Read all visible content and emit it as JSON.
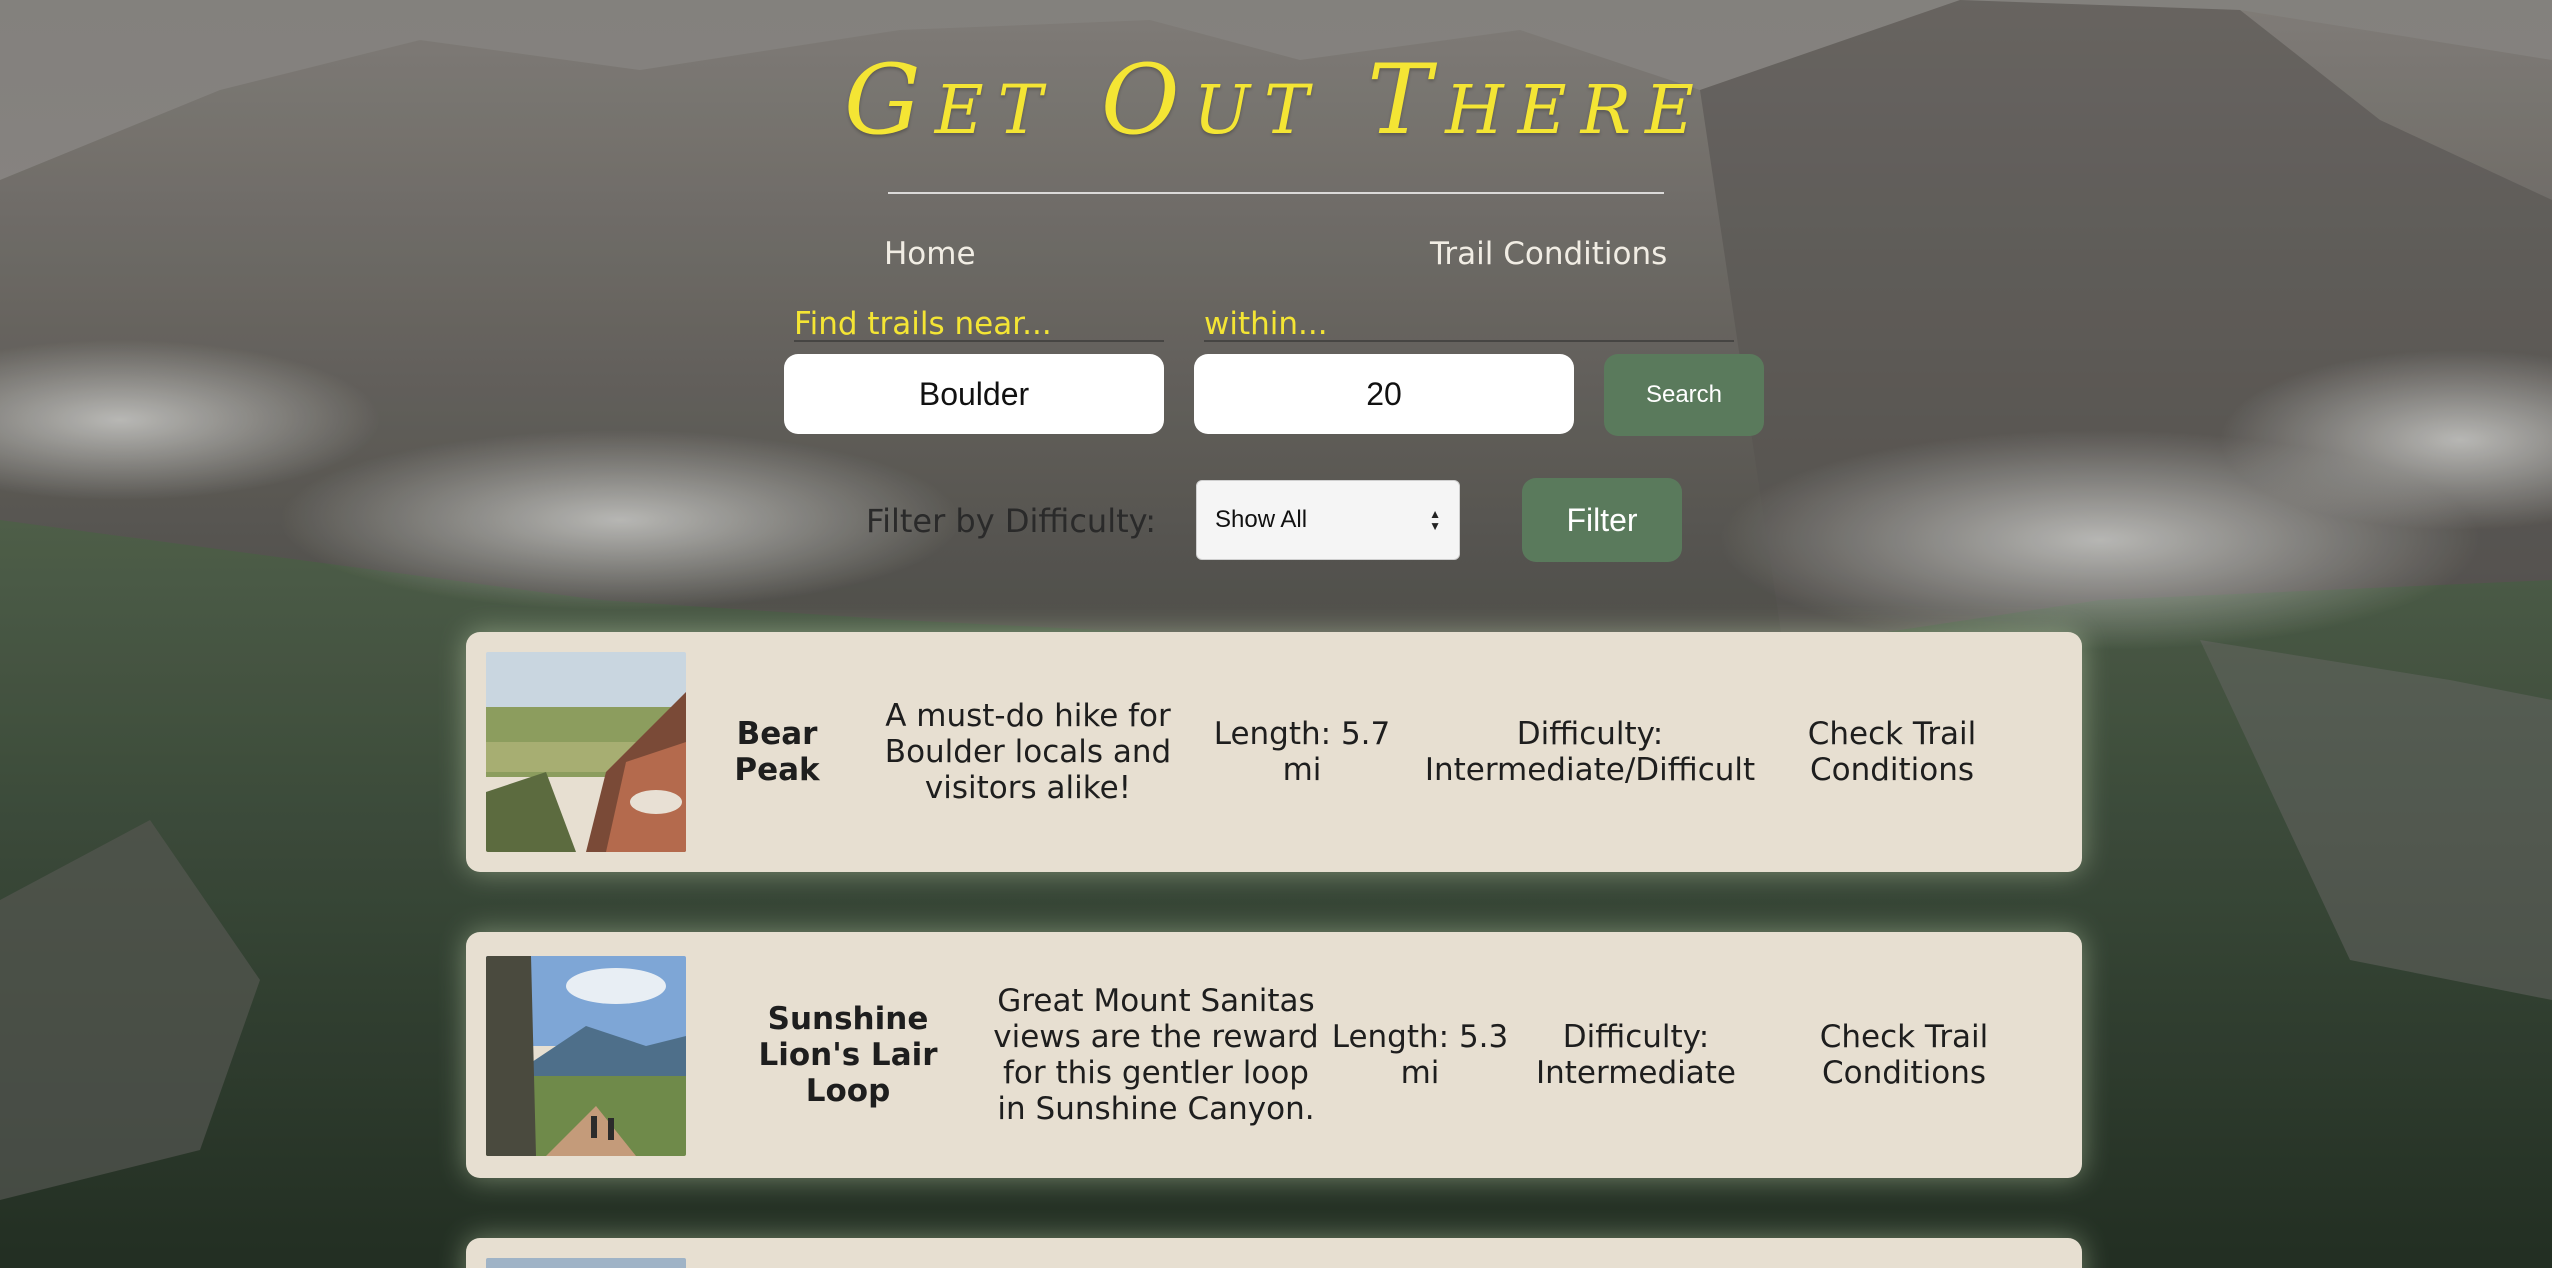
{
  "header": {
    "site_title": "Get Out There",
    "nav": {
      "home_label": "Home",
      "trail_conditions_label": "Trail Conditions"
    }
  },
  "search": {
    "near_label": "Find trails near...",
    "within_label": "within...",
    "near_value": "Boulder",
    "within_value": "20",
    "search_button_label": "Search"
  },
  "filter": {
    "label": "Filter by Difficulty:",
    "selected_option": "Show All",
    "filter_button_label": "Filter"
  },
  "trails": [
    {
      "name": "Bear Peak",
      "description": "A must-do hike for Boulder locals and visitors alike!",
      "length": "Length: 5.7 mi",
      "difficulty": "Difficulty: Intermediate/Difficult",
      "conditions_link": "Check Trail Conditions"
    },
    {
      "name": "Sunshine Lion's Lair Loop",
      "description": "Great Mount Sanitas views are the reward for this gentler loop in Sunshine Canyon.",
      "length": "Length: 5.3 mi",
      "difficulty": "Difficulty: Intermediate",
      "conditions_link": "Check Trail Conditions"
    }
  ],
  "colors": {
    "title_yellow": "#f4e534",
    "button_green": "#5a7a5c",
    "card_background": "#e7dfd1"
  }
}
